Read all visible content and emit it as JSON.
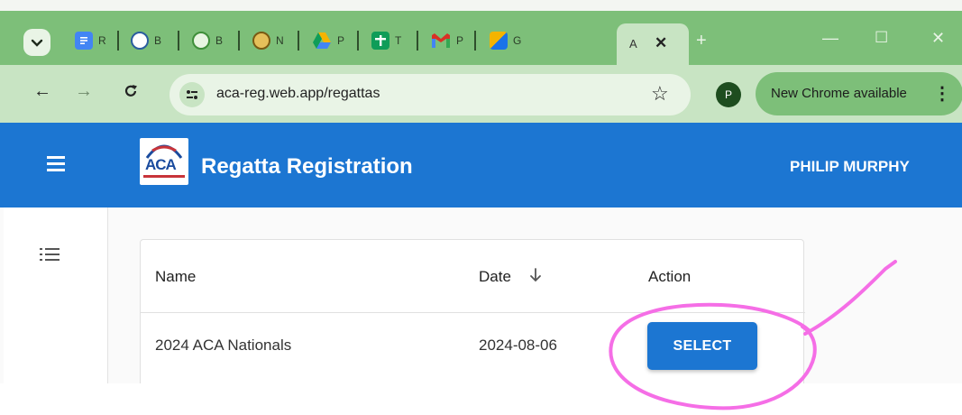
{
  "browser": {
    "tabs": [
      {
        "letter": "R",
        "icon": "docs-icon",
        "color": "#4285f4"
      },
      {
        "letter": "B",
        "icon": "seal-icon",
        "color": "#2a5d9f"
      },
      {
        "letter": "B",
        "icon": "seal-icon",
        "color": "#3f8f3a"
      },
      {
        "letter": "N",
        "icon": "emblem-icon",
        "color": "#c9a12a"
      },
      {
        "letter": "P",
        "icon": "drive-icon",
        "color": "#f4b400"
      },
      {
        "letter": "T",
        "icon": "sheets-cross-icon",
        "color": "#0f9d58"
      },
      {
        "letter": "P",
        "icon": "gmail-icon",
        "color": "#d93025"
      },
      {
        "letter": "G",
        "icon": "calendar-icon",
        "color": "#1a73e8"
      }
    ],
    "active_tab": {
      "label": "A"
    },
    "url": "aca-reg.web.app/regattas",
    "profile_initial": "P",
    "update_label": "New Chrome available",
    "theme": {
      "frame": "#7dbf79",
      "toolbar": "#c8e4c3",
      "omnibox": "#e9f4e6"
    }
  },
  "app": {
    "logo_text": "ACA",
    "title": "Regatta Registration",
    "user": "PHILIP MURPHY",
    "primary_color": "#1c76d2"
  },
  "table": {
    "columns": [
      "Name",
      "Date",
      "Action"
    ],
    "rows": [
      {
        "name": "2024 ACA Nationals",
        "date": "2024-08-06",
        "action": "SELECT"
      }
    ]
  },
  "annotation": {
    "color": "#f56ee6"
  }
}
